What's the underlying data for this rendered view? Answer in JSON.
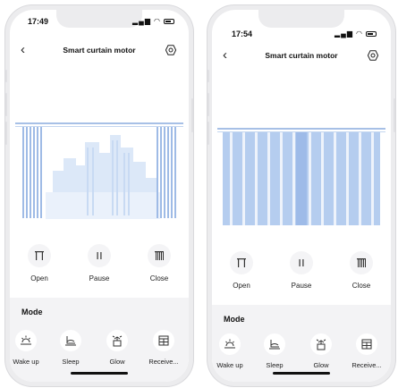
{
  "left_phone": {
    "time": "17:49",
    "title": "Smart curtain motor",
    "curtain_state": "open",
    "controls": [
      "Open",
      "Pause",
      "Close"
    ],
    "mode_title": "Mode",
    "modes": [
      "Wake up",
      "Sleep",
      "Glow",
      "Receive..."
    ]
  },
  "right_phone": {
    "time": "17:54",
    "title": "Smart curtain motor",
    "curtain_state": "closed",
    "controls": [
      "Open",
      "Pause",
      "Close"
    ],
    "mode_title": "Mode",
    "modes": [
      "Wake up",
      "Sleep",
      "Glow",
      "Receive..."
    ]
  },
  "icons": {
    "back": "back-icon",
    "settings": "settings-icon",
    "open": "curtain-open-icon",
    "pause": "pause-icon",
    "close": "curtain-close-icon",
    "wake_up": "sunrise-icon",
    "sleep": "sleep-icon",
    "glow": "glow-icon",
    "receive": "calendar-icon"
  },
  "colors": {
    "curtain": "#a9c4ea",
    "curtain_dark": "#8fb0e0",
    "rod": "#9db8e2",
    "city": "#d6e4f7",
    "panel": "#f3f3f5"
  }
}
